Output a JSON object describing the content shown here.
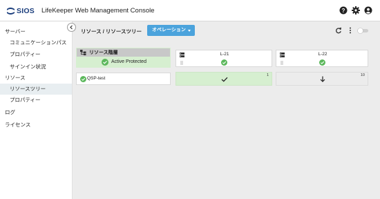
{
  "header": {
    "logo_text": "SIOS",
    "title": "LifeKeeper Web Management Console",
    "icons": [
      "help-icon",
      "gear-icon",
      "account-icon"
    ]
  },
  "sidebar": {
    "items": [
      {
        "label": "サーバー",
        "level": 1
      },
      {
        "label": "コミュニケーションパス",
        "level": 2
      },
      {
        "label": "プロパティー",
        "level": 2
      },
      {
        "label": "サインイン状況",
        "level": 2
      },
      {
        "label": "リソース",
        "level": 1
      },
      {
        "label": "リソースツリー",
        "level": 2,
        "active": true
      },
      {
        "label": "プロパティー",
        "level": 2
      },
      {
        "label": "ログ",
        "level": 1
      },
      {
        "label": "ライセンス",
        "level": 1
      }
    ]
  },
  "toolbar": {
    "breadcrumb": "リソース / リソースツリー",
    "operation_label": "オペレーション",
    "icons": [
      "refresh-icon",
      "more-vertical-icon",
      "toggle-switch"
    ]
  },
  "tree": {
    "hierarchy_title": "リソース階層",
    "hierarchy_status": "Active Protected",
    "nodes": [
      {
        "name": "L-21",
        "status": "check",
        "count": "1"
      },
      {
        "name": "L-22",
        "status": "standby",
        "count": "10"
      }
    ],
    "resource": {
      "name": "QSP-test",
      "status": "check"
    }
  },
  "colors": {
    "accent": "#4ba3dc",
    "active_green": "#d6efd0",
    "ok_green": "#5cb85c",
    "standby_gray": "#ececec",
    "header_gray": "#c8c8c8",
    "logo_blue": "#1a3d7c"
  }
}
